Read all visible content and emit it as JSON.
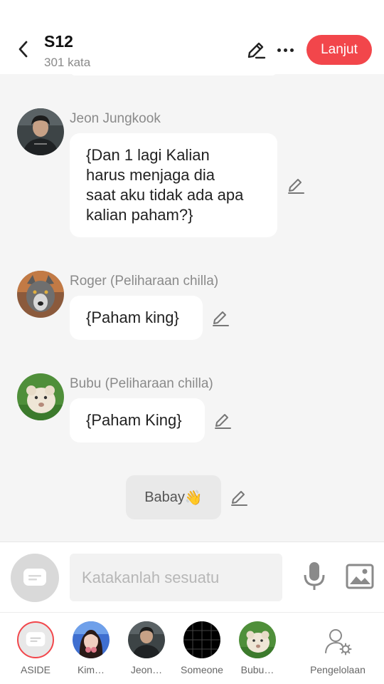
{
  "header": {
    "title": "S12",
    "word_count": "301 kata",
    "next_label": "Lanjut",
    "accent_color": "#f2464b"
  },
  "messages": [
    {
      "sender": "Jeon Jungkook",
      "text": "{Dan 1 lagi Kalian harus menjaga dia saat aku tidak ada apa kalian paham?}",
      "lines": [
        "{Dan 1 lagi Kalian",
        "harus menjaga dia",
        "saat aku tidak ada apa",
        "kalian paham?}"
      ]
    },
    {
      "sender": "Roger (Peliharaan chilla)",
      "text": "{Paham king}"
    },
    {
      "sender": "Bubu (Peliharaan chilla)",
      "text": "{Paham King}"
    }
  ],
  "narration": {
    "text": "Babay",
    "emoji": "👋"
  },
  "input": {
    "placeholder": "Katakanlah sesuatu",
    "value": ""
  },
  "characters": [
    {
      "label": "ASIDE",
      "icon": "chat-bubble-icon"
    },
    {
      "label": "Kim…"
    },
    {
      "label": "Jeon…"
    },
    {
      "label": "Someone"
    },
    {
      "label": "Bubu…"
    }
  ],
  "manage_label": "Pengelolaan"
}
